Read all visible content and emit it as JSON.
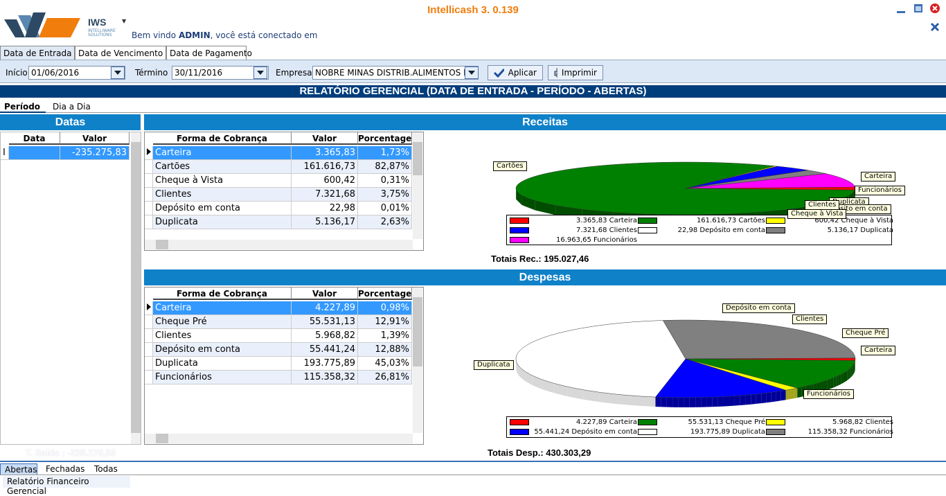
{
  "app": {
    "title": "Intellicash 3. 0.139",
    "logo_text": "IWS",
    "logo_sub": [
      "INTELLIWARE",
      "SOLUTIONS"
    ],
    "welcome_prefix": "Bem vindo ",
    "welcome_user": "ADMIN",
    "welcome_suffix": ", você está conectado em"
  },
  "top_tabs": [
    "Data de Entrada",
    "Data de Vencimento",
    "Data de Pagamento"
  ],
  "filters": {
    "inicio_label": "Início",
    "inicio_value": "01/06/2016",
    "termino_label": "Término",
    "termino_value": "30/11/2016",
    "empresa_label": "Empresa",
    "empresa_value": "NOBRE MINAS DISTRIB.ALIMENTOS E",
    "apply_label": "Aplicar",
    "print_label": "Imprimir"
  },
  "report_title": "RELATÓRIO GERENCIAL (DATA DE ENTRADA - PERÍODO - ABERTAS)",
  "sub_tabs": [
    "Período",
    "Dia a Dia"
  ],
  "datas": {
    "title": "Datas",
    "headers": [
      "Data",
      "Valor"
    ],
    "rows": [
      {
        "data": "",
        "valor": "-235.275,83"
      }
    ],
    "saldo": "T. Saldo : -235.275,83"
  },
  "receitas": {
    "title": "Receitas",
    "headers": [
      "Forma de Cobrança",
      "Valor",
      "Porcentagem"
    ],
    "rows": [
      {
        "forma": "Carteira",
        "valor": "3.365,83",
        "pct": "1,73%"
      },
      {
        "forma": "Cartões",
        "valor": "161.616,73",
        "pct": "82,87%"
      },
      {
        "forma": "Cheque à Vista",
        "valor": "600,42",
        "pct": "0,31%"
      },
      {
        "forma": "Clientes",
        "valor": "7.321,68",
        "pct": "3,75%"
      },
      {
        "forma": "Depósito em conta",
        "valor": "22,98",
        "pct": "0,01%"
      },
      {
        "forma": "Duplicata",
        "valor": "5.136,17",
        "pct": "2,63%"
      }
    ],
    "total": "Totais Rec.: 195.027,46"
  },
  "despesas": {
    "title": "Despesas",
    "headers": [
      "Forma de Cobrança",
      "Valor",
      "Porcentagem"
    ],
    "rows": [
      {
        "forma": "Carteira",
        "valor": "4.227,89",
        "pct": "0,98%"
      },
      {
        "forma": "Cheque Pré",
        "valor": "55.531,13",
        "pct": "12,91%"
      },
      {
        "forma": "Clientes",
        "valor": "5.968,82",
        "pct": "1,39%"
      },
      {
        "forma": "Depósito em conta",
        "valor": "55.441,24",
        "pct": "12,88%"
      },
      {
        "forma": "Duplicata",
        "valor": "193.775,89",
        "pct": "45,03%"
      },
      {
        "forma": "Funcionários",
        "valor": "115.358,32",
        "pct": "26,81%"
      }
    ],
    "total": "Totais Desp.: 430.303,29"
  },
  "chart_data": [
    {
      "type": "pie",
      "title": "Receitas",
      "labels": [
        "Carteira",
        "Cartões",
        "Cheque à Vista",
        "Clientes",
        "Depósito em conta",
        "Duplicata",
        "Funcionários"
      ],
      "values": [
        3365.83,
        161616.73,
        600.42,
        7321.68,
        22.98,
        5136.17,
        16963.65
      ],
      "value_labels": [
        "3.365,83",
        "161.616,73",
        "600,42",
        "7.321,68",
        "22,98",
        "5.136,17",
        "16.963,65"
      ],
      "colors": [
        "#ff0000",
        "#008000",
        "#ffff00",
        "#0000ff",
        "#ffffff",
        "#808080",
        "#ff00ff"
      ],
      "legend": "bottom"
    },
    {
      "type": "pie",
      "title": "Despesas",
      "labels": [
        "Carteira",
        "Cheque Pré",
        "Clientes",
        "Depósito em conta",
        "Duplicata",
        "Funcionários"
      ],
      "values": [
        4227.89,
        55531.13,
        5968.82,
        55441.24,
        193775.89,
        115358.32
      ],
      "value_labels": [
        "4.227,89",
        "55.531,13",
        "5.968,82",
        "55.441,24",
        "193.775,89",
        "115.358,32"
      ],
      "colors": [
        "#ff0000",
        "#008000",
        "#ffff00",
        "#0000ff",
        "#ffffff",
        "#808080"
      ],
      "legend": "bottom"
    }
  ],
  "bottom_tabs": [
    "Abertas",
    "Fechadas",
    "Todas"
  ],
  "footer_tab": "Relatório Financeiro Gerencial"
}
